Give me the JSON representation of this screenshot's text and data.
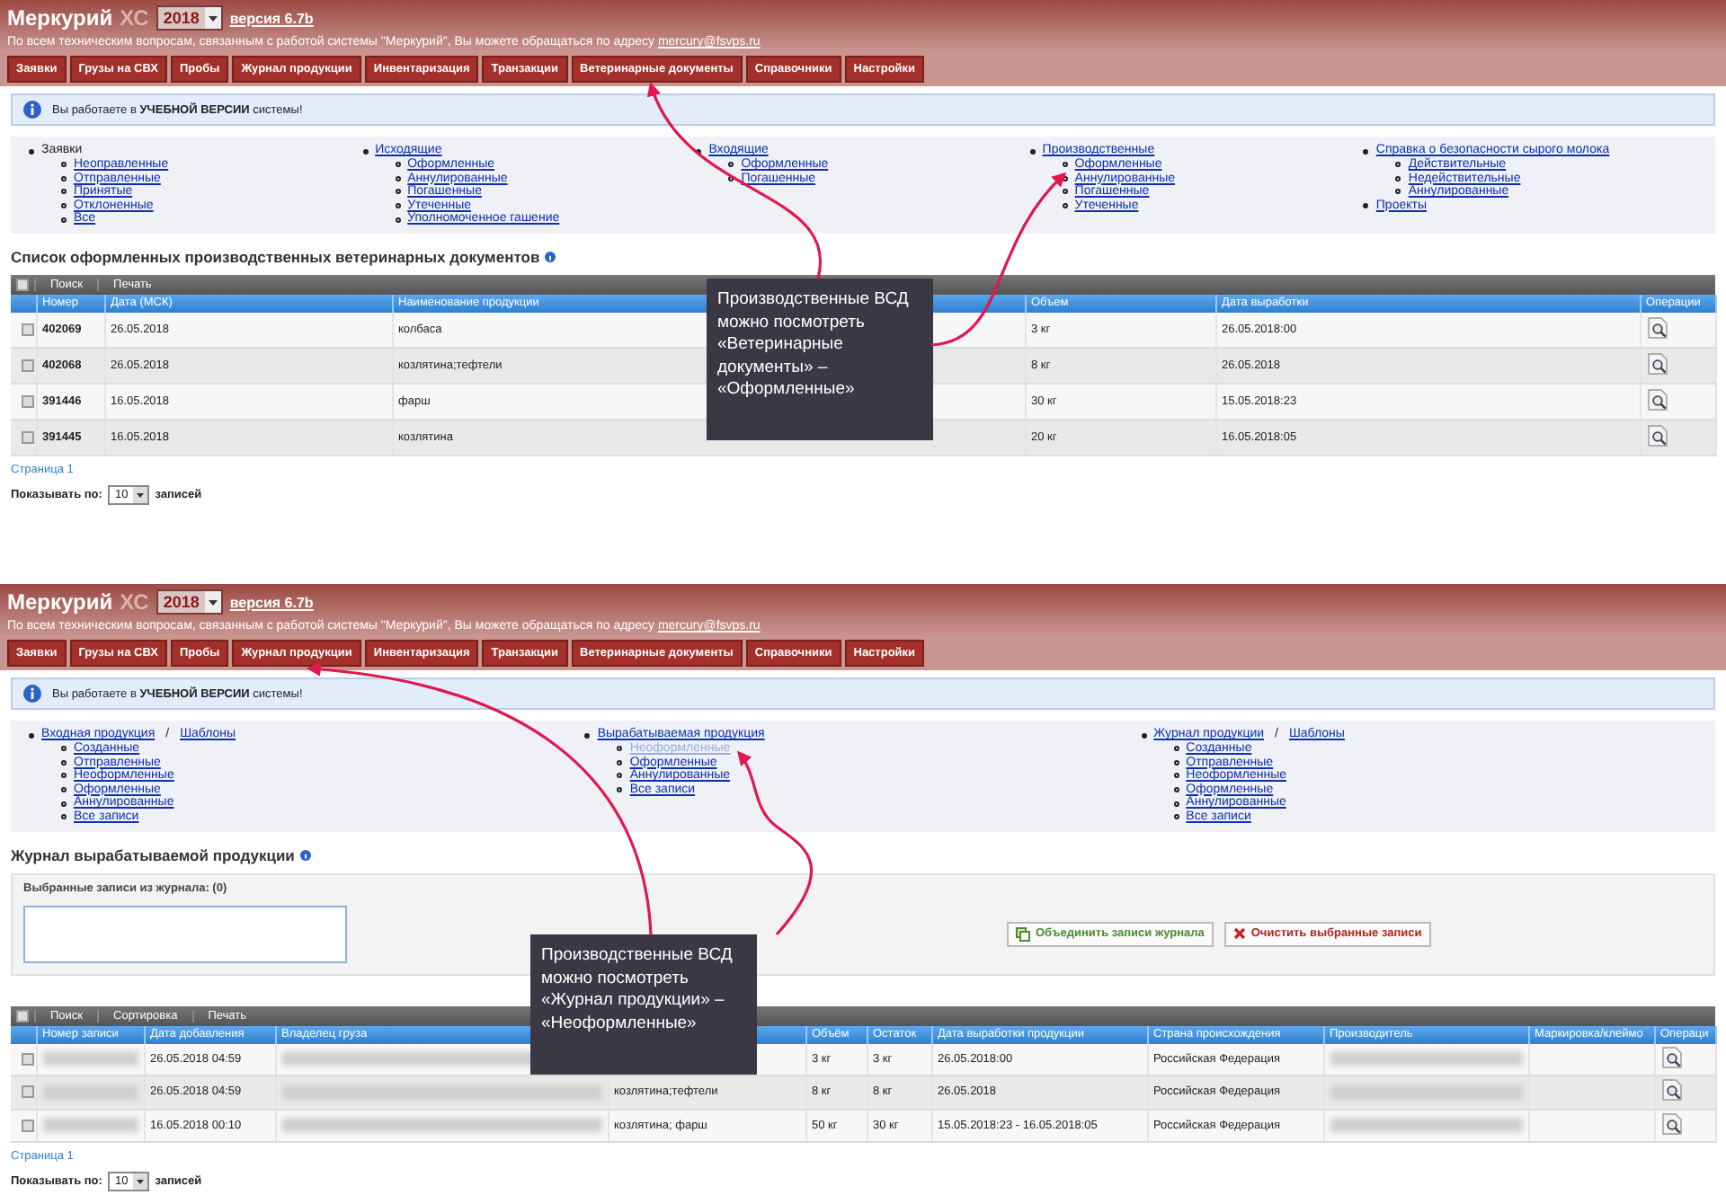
{
  "screens": [
    {
      "header": {
        "title": "Меркурий",
        "suffix": "ХС",
        "year": "2018",
        "version": "версия 6.7b"
      },
      "support": {
        "text": "По всем техническим вопросам, связанным с работой системы \"Меркурий\", Вы можете обращаться по адресу",
        "email": "mercury@fsvps.ru"
      },
      "nav_tabs": [
        "Заявки",
        "Грузы на СВХ",
        "Пробы",
        "Журнал продукции",
        "Инвентаризация",
        "Транзакции",
        "Ветеринарные документы",
        "Справочники",
        "Настройки"
      ],
      "notice": "Вы работаете в **УЧЕБНОЙ ВЕРСИИ** системы!",
      "link_columns": [
        [
          {
            "labels": [
              "Заявки"
            ],
            "kind": "text",
            "children": [
              {
                "label": "Неоправленные",
                "selected": false
              },
              {
                "label": "Отправленные",
                "selected": false
              },
              {
                "label": "Принятые",
                "selected": false
              },
              {
                "label": "Отклоненные",
                "selected": false
              },
              {
                "label": "Все",
                "selected": false
              }
            ]
          }
        ],
        [
          {
            "labels": [
              "Исходящие"
            ],
            "kind": "link",
            "children": [
              {
                "label": "Оформленные",
                "selected": false
              },
              {
                "label": "Аннулированные",
                "selected": false
              },
              {
                "label": "Погашенные",
                "selected": false
              },
              {
                "label": "Утеченные",
                "selected": false
              },
              {
                "label": "Уполномоченное гашение",
                "selected": false
              }
            ]
          }
        ],
        [
          {
            "labels": [
              "Входящие"
            ],
            "kind": "link",
            "children": [
              {
                "label": "Оформленные",
                "selected": false
              },
              {
                "label": "Погашенные",
                "selected": false
              }
            ]
          }
        ],
        [
          {
            "labels": [
              "Производственные"
            ],
            "kind": "link",
            "children": [
              {
                "label": "Оформленные",
                "selected": false
              },
              {
                "label": "Аннулированные",
                "selected": false
              },
              {
                "label": "Погашенные",
                "selected": false
              },
              {
                "label": "Утеченные",
                "selected": false
              }
            ]
          }
        ],
        [
          {
            "labels": [
              "Справка о безопасности сырого молока"
            ],
            "kind": "link",
            "children": [
              {
                "label": "Действительные",
                "selected": false
              },
              {
                "label": "Недействительные",
                "selected": false
              },
              {
                "label": "Аннулированные",
                "selected": false
              }
            ]
          },
          {
            "labels": [
              "Проекты"
            ],
            "kind": "link"
          }
        ]
      ],
      "section_title": "Список оформленных производственных ветеринарных документов",
      "select_all": {
        "checked": false
      },
      "toolbar": [
        "Поиск",
        "Печать"
      ],
      "table": {
        "columns": [
          "Номер",
          "Дата (МСК)",
          "Наименование продукции",
          "Объем",
          "Дата выработки",
          "Операции"
        ],
        "rows": [
          {
            "checked": false,
            "cells": [
              "402069",
              "26.05.2018",
              "колбаса",
              "3 кг",
              "26.05.2018:00"
            ]
          },
          {
            "checked": false,
            "cells": [
              "402068",
              "26.05.2018",
              "козлятина;тефтели",
              "8 кг",
              "26.05.2018"
            ]
          },
          {
            "checked": false,
            "cells": [
              "391446",
              "16.05.2018",
              "фарш",
              "30 кг",
              "15.05.2018:23"
            ]
          },
          {
            "checked": false,
            "cells": [
              "391445",
              "16.05.2018",
              "козлятина",
              "20 кг",
              "16.05.2018:05"
            ]
          }
        ]
      },
      "pagination": "Страница 1",
      "page_size": {
        "label": "Показывать по:",
        "value": "10",
        "suffix": "записей"
      },
      "callout": "Производственные ВСД можно посмотреть «Ветеринарные документы» – «Оформленные»"
    },
    {
      "header": {
        "title": "Меркурий",
        "suffix": "ХС",
        "year": "2018",
        "version": "версия 6.7b"
      },
      "support": {
        "text": "По всем техническим вопросам, связанным с работой системы \"Меркурий\", Вы можете обращаться по адресу",
        "email": "mercury@fsvps.ru"
      },
      "nav_tabs": [
        "Заявки",
        "Грузы на СВХ",
        "Пробы",
        "Журнал продукции",
        "Инвентаризация",
        "Транзакции",
        "Ветеринарные документы",
        "Справочники",
        "Настройки"
      ],
      "notice": "Вы работаете в **УЧЕБНОЙ ВЕРСИИ** системы!",
      "link_columns": [
        [
          {
            "labels": [
              "Входная продукция",
              "Шаблоны"
            ],
            "separator": "/",
            "kind": "link",
            "children": [
              {
                "label": "Созданные",
                "selected": false
              },
              {
                "label": "Отправленные",
                "selected": false
              },
              {
                "label": "Неоформленные",
                "selected": false
              },
              {
                "label": "Оформленные",
                "selected": false
              },
              {
                "label": "Аннулированные",
                "selected": false
              },
              {
                "label": "Все записи",
                "selected": false
              }
            ]
          }
        ],
        [
          {
            "labels": [
              "Вырабатываемая продукция"
            ],
            "kind": "link",
            "children": [
              {
                "label": "Неоформленные",
                "selected": true
              },
              {
                "label": "Оформленные",
                "selected": false
              },
              {
                "label": "Аннулированные",
                "selected": false
              },
              {
                "label": "Все записи",
                "selected": false
              }
            ]
          }
        ],
        [
          {
            "labels": [
              "Журнал продукции",
              "Шаблоны"
            ],
            "separator": "/",
            "kind": "link",
            "children": [
              {
                "label": "Созданные",
                "selected": false
              },
              {
                "label": "Отправленные",
                "selected": false
              },
              {
                "label": "Неоформленные",
                "selected": false
              },
              {
                "label": "Оформленные",
                "selected": false
              },
              {
                "label": "Аннулированные",
                "selected": false
              },
              {
                "label": "Все записи",
                "selected": false
              }
            ]
          }
        ]
      ],
      "section_title": "Журнал вырабатываемой продукции",
      "selection": {
        "label": "Выбранные записи из журнала: (0)",
        "buttons": [
          {
            "kind": "merge",
            "label": "Объединить записи журнала"
          },
          {
            "kind": "clear",
            "label": "Очистить выбранные записи"
          }
        ]
      },
      "select_all": {
        "checked": false
      },
      "toolbar": [
        "Поиск",
        "Сортировка",
        "Печать"
      ],
      "table": {
        "columns": [
          "Номер записи",
          "Дата добавления",
          "Владелец груза",
          null,
          "Объём",
          "Остаток",
          "Дата выработки продукции",
          "Страна происхождения",
          "Производитель",
          "Маркировка/клеймо",
          "Операци"
        ],
        "rows": [
          {
            "checked": false,
            "cells": [
              {
                "kind": "blurred"
              },
              "26.05.2018 04:59",
              {
                "kind": "blurred"
              },
              {
                "kind": "covered"
              },
              "3 кг",
              "3 кг",
              "26.05.2018:00",
              "Российская Федерация",
              {
                "kind": "blurred"
              },
              {
                "kind": "empty"
              }
            ]
          },
          {
            "checked": false,
            "cells": [
              {
                "kind": "blurred"
              },
              "26.05.2018 04:59",
              {
                "kind": "blurred"
              },
              "козлятина;тефтели",
              "8 кг",
              "8 кг",
              "26.05.2018",
              "Российская Федерация",
              {
                "kind": "blurred"
              },
              {
                "kind": "empty"
              }
            ]
          },
          {
            "checked": false,
            "cells": [
              {
                "kind": "blurred"
              },
              "16.05.2018 00:10",
              {
                "kind": "blurred"
              },
              "козлятина; фарш",
              "50 кг",
              "30 кг",
              "15.05.2018:23 - 16.05.2018:05",
              "Российская Федерация",
              {
                "kind": "blurred"
              },
              {
                "kind": "empty"
              }
            ]
          }
        ]
      },
      "pagination": "Страница 1",
      "page_size": {
        "label": "Показывать по:",
        "value": "10",
        "suffix": "записей"
      },
      "callout": "Производственные ВСД можно посмотреть «Журнал продукции» – «Неоформленные»"
    }
  ]
}
